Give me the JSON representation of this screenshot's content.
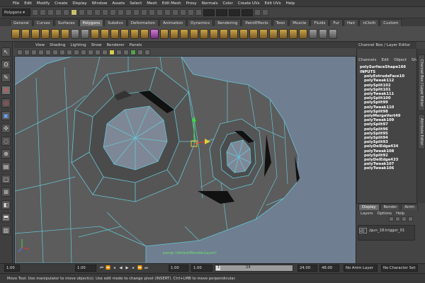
{
  "menubar": {
    "items": [
      "File",
      "Edit",
      "Modify",
      "Create",
      "Display",
      "Window",
      "Assets",
      "Select",
      "Mesh",
      "Edit Mesh",
      "Proxy",
      "Normals",
      "Color",
      "Create UVs",
      "Edit UVs",
      "Help"
    ]
  },
  "statusline": {
    "mode": "Polygons"
  },
  "shelf": {
    "tabs": [
      "General",
      "Curves",
      "Surfaces",
      "Polygons",
      "Subdivs",
      "Deformation",
      "Animation",
      "Dynamics",
      "Rendering",
      "PaintEffects",
      "Toon",
      "Muscle",
      "Fluids",
      "Fur",
      "Hair",
      "nCloth",
      "Custom"
    ],
    "active_tab": "Polygons"
  },
  "viewport": {
    "menu": [
      "View",
      "Shading",
      "Lighting",
      "Show",
      "Renderer",
      "Panels"
    ],
    "camera_label": "persp (defaultRenderLayer)",
    "background_color": "#6f7e90",
    "mesh_color": "#5c5c5c",
    "wire_color": "#66c7d9"
  },
  "channel_box": {
    "title": "Channel Box / Layer Editor",
    "menu": [
      "Channels",
      "Edit",
      "Object",
      "Show"
    ],
    "shape_node": "polySurfaceShape166",
    "inputs_label": "INPUTS",
    "inputs": [
      "polyExtrudeFace10",
      "polyTweak112",
      "polySplit102",
      "polySplit101",
      "polyTweak111",
      "polySplit100",
      "polySplit99",
      "polyTweak110",
      "polySplit98",
      "polyMergeVert49",
      "polyTweak109",
      "polySplit97",
      "polySplit96",
      "polySplit95",
      "polySplit94",
      "polySplit93",
      "polyDelEdge434",
      "polyTweak108",
      "polySplit92",
      "polyDelEdge433",
      "polyTweak107",
      "polyTweak106"
    ],
    "side_tabs": [
      "Channel Box / Layer Editor",
      "Attribute Editor"
    ]
  },
  "layer_editor": {
    "tabs": [
      "Display",
      "Render",
      "Anim"
    ],
    "active_tab": "Display",
    "menu": [
      "Layers",
      "Options",
      "Help"
    ],
    "layers": [
      {
        "visible": "V",
        "name": "/gun_18:trigger_01"
      }
    ]
  },
  "timeline": {
    "start_field": "1.00",
    "current_field": "1.00",
    "anim_start": "1.00",
    "range_start": "1.00",
    "range_inner_start": "1",
    "range_inner_end": "24",
    "range_end": "24.00",
    "anim_end": "48.00",
    "anim_layer": "No Anim Layer",
    "character_set": "No Character Set"
  },
  "help_line": "Move Tool: Use manipulator to move object(s). Use edit mode to change pivot (INSERT). Ctrl+LMB to move perpendicular."
}
